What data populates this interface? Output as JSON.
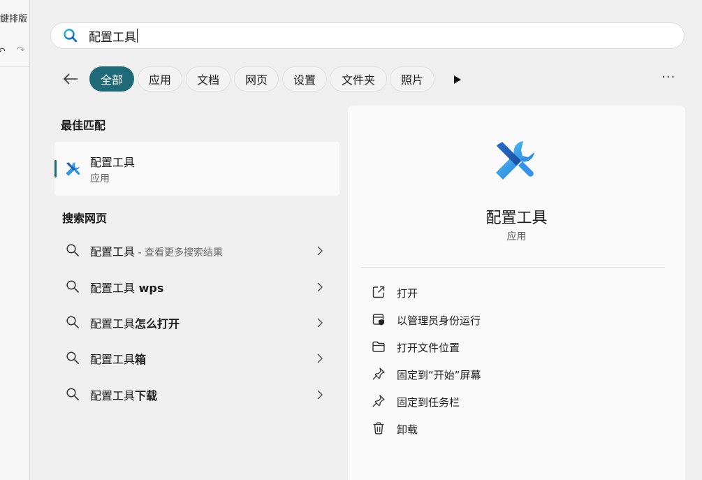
{
  "background_app": {
    "title_fragment": "鍵排版",
    "undo_glyph": "↶",
    "redo_glyph": "↷"
  },
  "search": {
    "query": "配置工具",
    "icon": "search-icon"
  },
  "filters": {
    "back_icon": "arrow-left-icon",
    "chips": [
      "全部",
      "应用",
      "文档",
      "网页",
      "设置",
      "文件夹",
      "照片"
    ],
    "active_index": 0,
    "more_icon": "play-triangle-icon",
    "overflow_label": "···"
  },
  "best_match": {
    "heading": "最佳匹配",
    "title": "配置工具",
    "subtitle": "应用",
    "icon": "tools-icon"
  },
  "web_search": {
    "heading": "搜索网页",
    "items": [
      {
        "base": "配置工具",
        "suffix": "",
        "dim": " - 查看更多搜索结果"
      },
      {
        "base": "配置工具",
        "suffix": " wps",
        "dim": ""
      },
      {
        "base": "配置工具",
        "suffix": "怎么打开",
        "dim": ""
      },
      {
        "base": "配置工具",
        "suffix": "箱",
        "dim": ""
      },
      {
        "base": "配置工具",
        "suffix": "下载",
        "dim": ""
      }
    ]
  },
  "detail": {
    "title": "配置工具",
    "subtitle": "应用",
    "actions": [
      {
        "label": "打开",
        "icon": "open-external-icon"
      },
      {
        "label": "以管理员身份运行",
        "icon": "admin-shield-icon"
      },
      {
        "label": "打开文件位置",
        "icon": "folder-icon"
      },
      {
        "label": "固定到“开始”屏幕",
        "icon": "pin-icon"
      },
      {
        "label": "固定到任务栏",
        "icon": "pin-icon"
      },
      {
        "label": "卸载",
        "icon": "trash-icon"
      }
    ]
  },
  "colors": {
    "accent": "#1f6a78",
    "icon_blue": "#2b88d8"
  }
}
